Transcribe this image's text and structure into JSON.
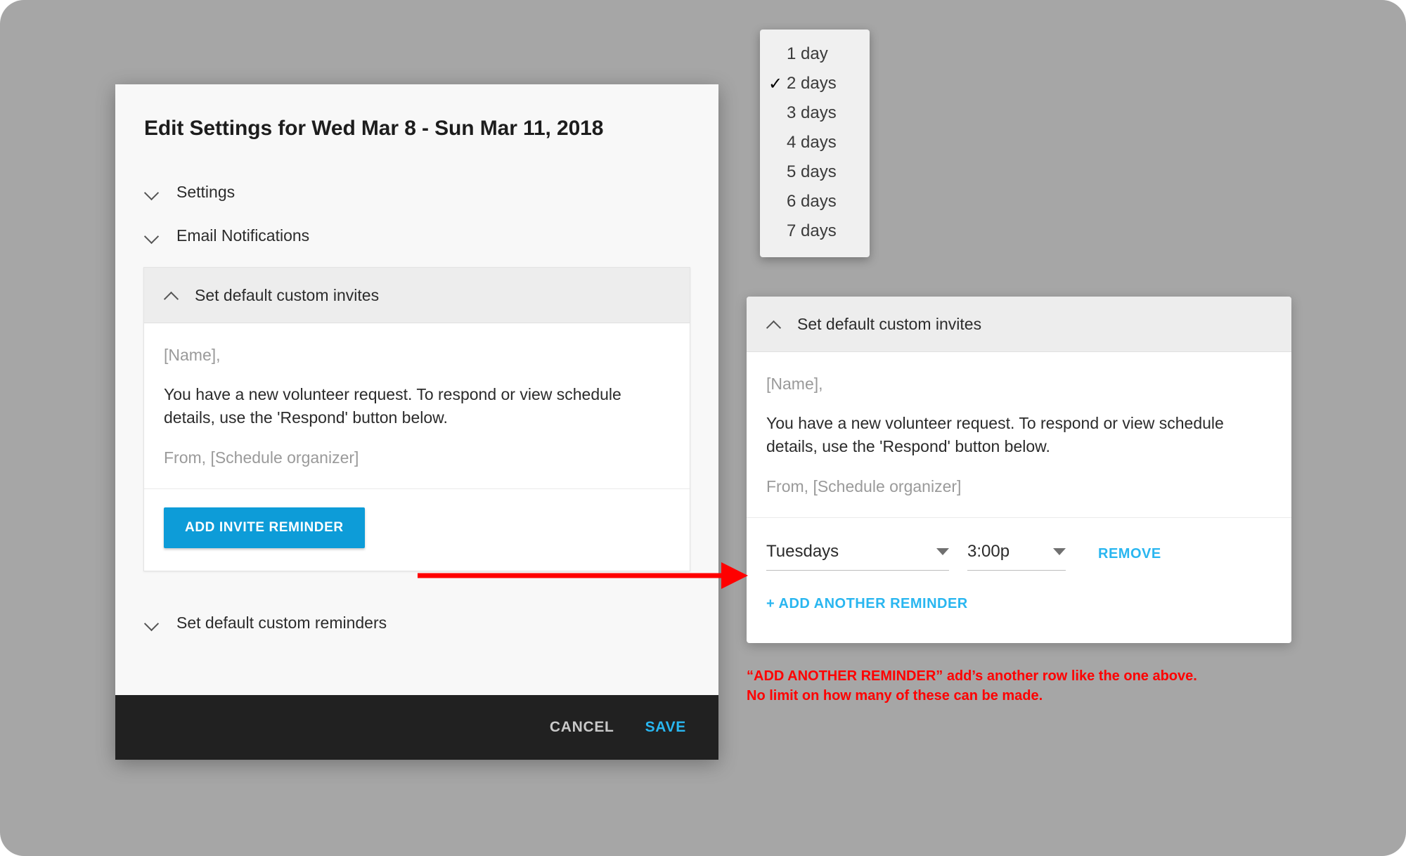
{
  "colors": {
    "background": "#a6a6a6",
    "accent_blue": "#0d9cd8",
    "link_blue": "#29b6f0",
    "annotation_red": "#ff0000",
    "footer_dark": "#212121"
  },
  "dialog": {
    "title": "Edit Settings for Wed Mar 8 - Sun Mar 11, 2018",
    "sections": [
      {
        "label": "Settings",
        "icon": "chevron-down-icon",
        "expanded": false
      },
      {
        "label": "Email Notifications",
        "icon": "chevron-down-icon",
        "expanded": false
      },
      {
        "label": "Set default custom reminders",
        "icon": "chevron-down-icon",
        "expanded": false
      }
    ],
    "invites_panel": {
      "header_label": "Set default custom invites",
      "header_icon": "chevron-up-icon",
      "greeting": "[Name],",
      "body": "You have a new volunteer request. To respond or view schedule details, use the 'Respond' button below.",
      "signature": "From, [Schedule organizer]",
      "add_reminder_label": "ADD INVITE REMINDER"
    },
    "footer": {
      "cancel_label": "CANCEL",
      "save_label": "SAVE"
    }
  },
  "dropdown": {
    "items": [
      {
        "label": "1 day",
        "checked": false
      },
      {
        "label": "2 days",
        "checked": true
      },
      {
        "label": "3 days",
        "checked": false
      },
      {
        "label": "4 days",
        "checked": false
      },
      {
        "label": "5 days",
        "checked": false
      },
      {
        "label": "6 days",
        "checked": false
      },
      {
        "label": "7 days",
        "checked": false
      }
    ],
    "check_glyph": "✓",
    "selected": "2 days"
  },
  "right_panel": {
    "header_label": "Set default custom invites",
    "header_icon": "chevron-up-icon",
    "greeting": "[Name],",
    "body": "You have a new volunteer request. To respond or view schedule details, use the 'Respond' button below.",
    "signature": "From, [Schedule organizer]",
    "reminder": {
      "day_value": "Tuesdays",
      "time_value": "3:00p",
      "remove_label": "REMOVE"
    },
    "add_another_label": "+ ADD ANOTHER REMINDER"
  },
  "annotation": {
    "line1": "“ADD ANOTHER REMINDER” add’s another row like the one above.",
    "line2": "No limit on how many of these can be made."
  }
}
